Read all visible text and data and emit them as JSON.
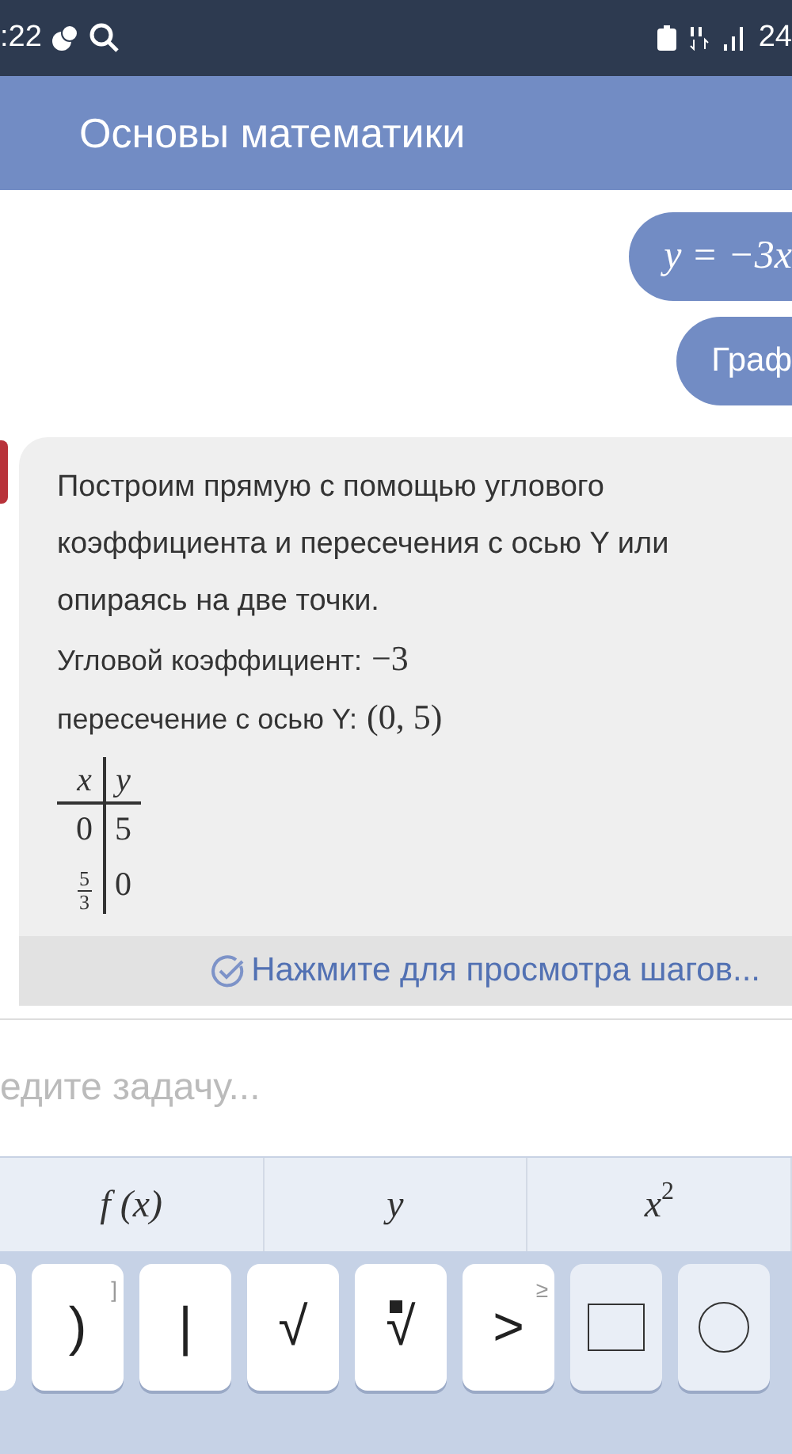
{
  "status_bar": {
    "time": ":22",
    "battery": "24"
  },
  "header": {
    "title": "Основы математики"
  },
  "chat": {
    "user_messages": [
      "y = −3x",
      "Граф"
    ],
    "answer": {
      "intro": "Построим прямую с помощью углового коэффициента и пересечения с осью Y или опираясь на две точки.",
      "facts": [
        {
          "label": "Угловой коэффициент:",
          "value": "−3"
        },
        {
          "label": "пересечение с осью Y:",
          "value": "(0, 5)"
        }
      ],
      "table": {
        "columns": [
          "x",
          "y"
        ],
        "rows": [
          [
            {
              "kind": "number",
              "text": "0"
            },
            {
              "kind": "number",
              "text": "5"
            }
          ],
          [
            {
              "kind": "fraction",
              "numerator": "5",
              "denominator": "3"
            },
            {
              "kind": "number",
              "text": "0"
            }
          ]
        ]
      },
      "steps_link": "Нажмите для просмотра шагов..."
    }
  },
  "input": {
    "placeholder": "едите задачу..."
  },
  "keyboard": {
    "tabs": [
      {
        "kind": "func",
        "label": "f (x)"
      },
      {
        "kind": "var",
        "label": "y"
      },
      {
        "kind": "power",
        "label": "x",
        "exp": "2"
      }
    ],
    "keys": [
      {
        "kind": "symbol",
        "label": ")",
        "alt": "]"
      },
      {
        "kind": "symbol",
        "label": "|"
      },
      {
        "kind": "symbol",
        "label": "√"
      },
      {
        "kind": "root",
        "label": "√"
      },
      {
        "kind": "symbol",
        "label": ">",
        "alt": "≥"
      },
      {
        "kind": "square"
      },
      {
        "kind": "circle"
      }
    ]
  }
}
